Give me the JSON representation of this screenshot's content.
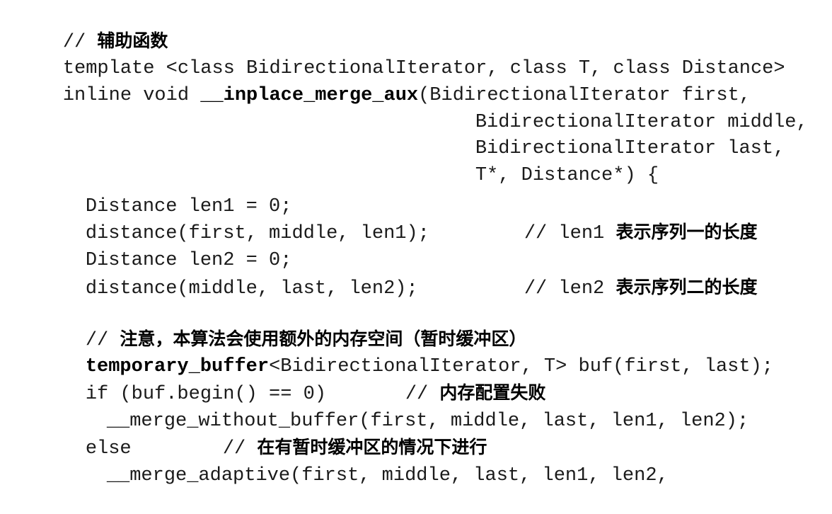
{
  "code": {
    "l1": {
      "pre": "// ",
      "cn": "辅助函数"
    },
    "l2": "template <class BidirectionalIterator, class T, class Distance>",
    "l3": {
      "pre": "inline void ",
      "fn": "__inplace_merge_aux",
      "post": "(BidirectionalIterator first,"
    },
    "l4": "BidirectionalIterator middle,",
    "l5": "BidirectionalIterator last,",
    "l6": "T*, Distance*) {",
    "l7": "Distance len1 = 0;",
    "l8": {
      "code": "distance(first, middle, len1);",
      "cpre": "// len1 ",
      "cn": "表示序列一的长度"
    },
    "l9": "Distance len2 = 0;",
    "l10": {
      "code": "distance(middle, last, len2);",
      "cpre": "// len2 ",
      "cn": "表示序列二的长度"
    },
    "l11": {
      "pre": "// ",
      "cn": "注意，本算法会使用额外的内存空间（暂时缓冲区）"
    },
    "l12": {
      "kw": "temporary_buffer",
      "post": "<BidirectionalIterator, T> buf(first, last);"
    },
    "l13": {
      "code": "if (buf.begin() == 0)",
      "cpre": "// ",
      "cn": "内存配置失败"
    },
    "l14": "__merge_without_buffer(first, middle, last, len1, len2);",
    "l15": {
      "code": "else",
      "cpre": "// ",
      "cn": "在有暂时缓冲区的情况下进行"
    },
    "l16": "__merge_adaptive(first, middle, last, len1, len2,"
  }
}
